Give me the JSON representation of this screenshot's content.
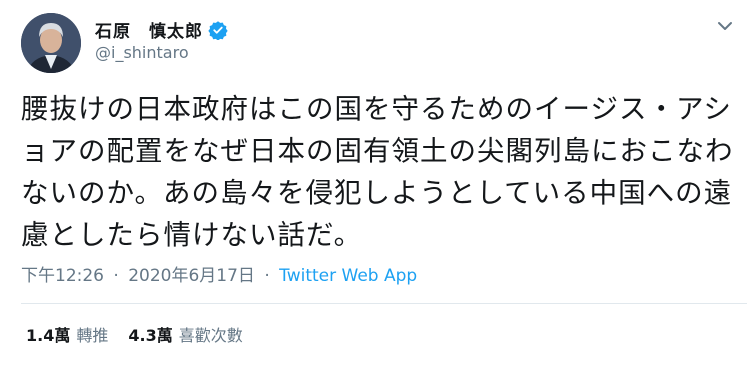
{
  "author": {
    "display_name": "石原　慎太郎",
    "handle": "@i_shintaro",
    "avatar_icon": "profile-photo",
    "verified_icon": "verified-badge-icon"
  },
  "menu_icon": "chevron-down-icon",
  "tweet": {
    "text": "腰抜けの日本政府はこの国を守るためのイージス・アショアの配置をなぜ日本の固有領土の尖閣列島におこなわないのか。あの島々を侵犯しようとしている中国への遠慮としたら情けない話だ。",
    "time": "下午12:26",
    "separator": "·",
    "date": "2020年6月17日",
    "source": "Twitter Web App"
  },
  "stats": {
    "retweets_count": "1.4萬",
    "retweets_label": "轉推",
    "likes_count": "4.3萬",
    "likes_label": "喜歡次數"
  },
  "colors": {
    "text": "#14171a",
    "secondary": "#657786",
    "link": "#1da1f2",
    "divider": "#e1e8ed"
  }
}
